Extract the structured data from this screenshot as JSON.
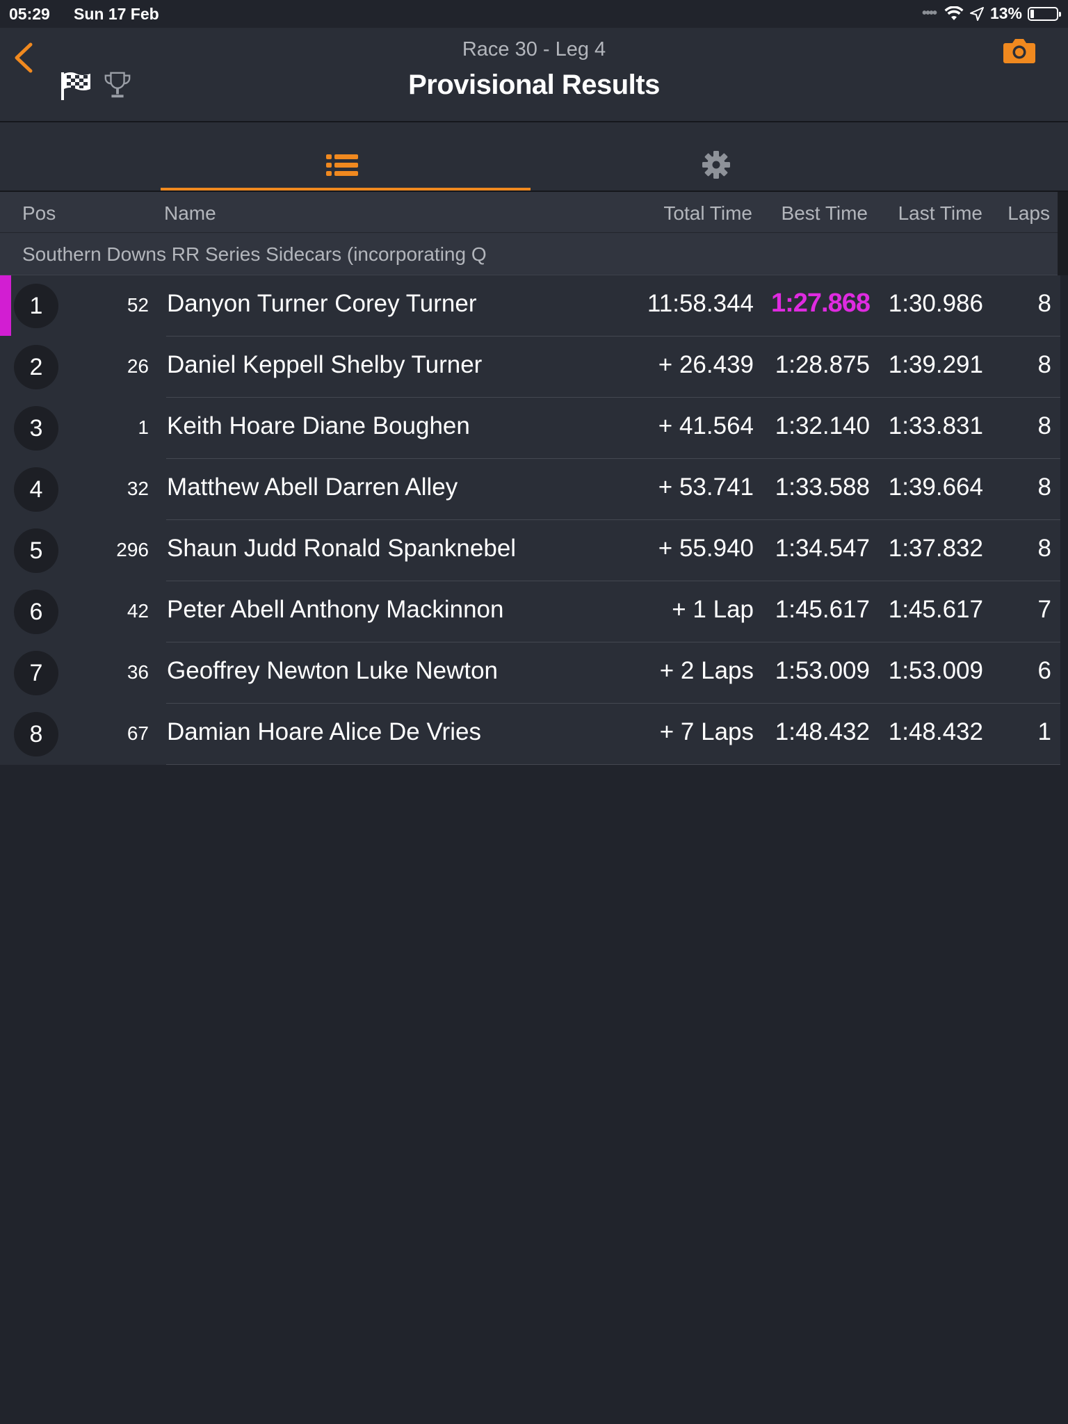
{
  "status_bar": {
    "time": "05:29",
    "date": "Sun 17 Feb",
    "battery": "13%"
  },
  "header": {
    "subtitle": "Race 30 -  Leg 4",
    "title": "Provisional Results"
  },
  "tabs": [
    {
      "icon": "list-icon",
      "active": true
    },
    {
      "icon": "gear-icon",
      "active": false
    }
  ],
  "columns": {
    "pos": "Pos",
    "name": "Name",
    "total_time": "Total Time",
    "best_time": "Best Time",
    "last_time": "Last Time",
    "laps": "Laps"
  },
  "group_title": "Southern Downs RR Series Sidecars (incorporating Q",
  "results": [
    {
      "pos": "1",
      "num": "52",
      "name": "Danyon Turner Corey Turner",
      "total": "11:58.344",
      "best": "1:27.868",
      "last": "1:30.986",
      "laps": "8"
    },
    {
      "pos": "2",
      "num": "26",
      "name": "Daniel Keppell Shelby Turner",
      "total": "+ 26.439",
      "best": "1:28.875",
      "last": "1:39.291",
      "laps": "8"
    },
    {
      "pos": "3",
      "num": "1",
      "name": "Keith Hoare Diane Boughen",
      "total": "+ 41.564",
      "best": "1:32.140",
      "last": "1:33.831",
      "laps": "8"
    },
    {
      "pos": "4",
      "num": "32",
      "name": "Matthew Abell Darren Alley",
      "total": "+ 53.741",
      "best": "1:33.588",
      "last": "1:39.664",
      "laps": "8"
    },
    {
      "pos": "5",
      "num": "296",
      "name": "Shaun Judd Ronald Spanknebel",
      "total": "+ 55.940",
      "best": "1:34.547",
      "last": "1:37.832",
      "laps": "8"
    },
    {
      "pos": "6",
      "num": "42",
      "name": "Peter Abell Anthony Mackinnon",
      "total": "+ 1 Lap",
      "best": "1:45.617",
      "last": "1:45.617",
      "laps": "7"
    },
    {
      "pos": "7",
      "num": "36",
      "name": "Geoffrey Newton Luke Newton",
      "total": "+ 2 Laps",
      "best": "1:53.009",
      "last": "1:53.009",
      "laps": "6"
    },
    {
      "pos": "8",
      "num": "67",
      "name": "Damian Hoare Alice De Vries",
      "total": "+ 7 Laps",
      "best": "1:48.432",
      "last": "1:48.432",
      "laps": "1"
    }
  ],
  "colors": {
    "accent": "#f0891f",
    "fastest_lap": "#df2be0",
    "background": "#21242c",
    "row": "#2a2e37"
  }
}
